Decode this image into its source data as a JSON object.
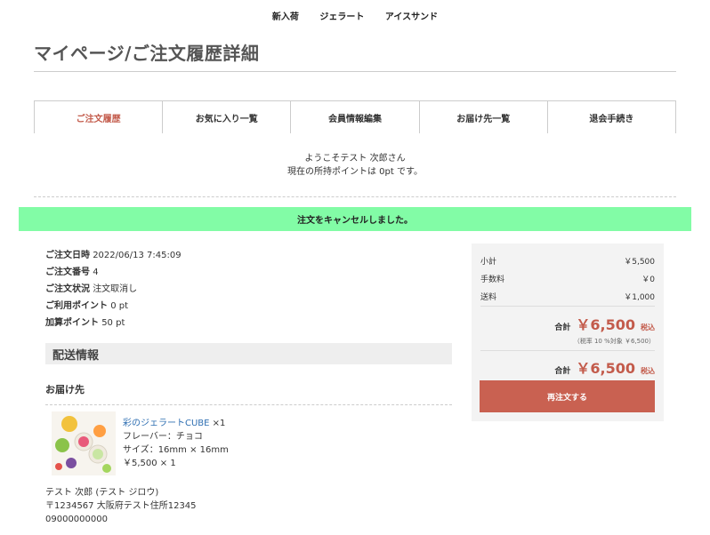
{
  "nav": {
    "items": [
      "新入荷",
      "ジェラート",
      "アイスサンド"
    ]
  },
  "page_title": "マイページ/ご注文履歴詳細",
  "tabs": [
    "ご注文履歴",
    "お気に入り一覧",
    "会員情報編集",
    "お届け先一覧",
    "退会手続き"
  ],
  "welcome": {
    "line1": "ようこそテスト 次郎さん",
    "line2": "現在の所持ポイントは 0pt です。"
  },
  "alert_message": "注文をキャンセルしました。",
  "order_info": {
    "date_label": "ご注文日時",
    "date_value": "2022/06/13 7:45:09",
    "number_label": "ご注文番号",
    "number_value": "4",
    "status_label": "ご注文状況",
    "status_value": "注文取消し",
    "used_points_label": "ご利用ポイント",
    "used_points_value": "0 pt",
    "added_points_label": "加算ポイント",
    "added_points_value": "50 pt"
  },
  "shipping": {
    "section_title": "配送情報",
    "ship_to_label": "お届け先",
    "product_name": "彩のジェラートCUBE",
    "product_qty": "×1",
    "flavor": "フレーバー：チョコ",
    "size": "サイズ：16mm × 16mm",
    "price": "￥5,500 × 1",
    "recipient": "テスト 次郎 (テスト ジロウ)",
    "address": "〒1234567 大阪府テスト住所12345",
    "phone": "09000000000"
  },
  "summary": {
    "subtotal_label": "小計",
    "subtotal_value": "￥5,500",
    "fee_label": "手数料",
    "fee_value": "￥0",
    "shipping_label": "送料",
    "shipping_value": "￥1,000",
    "total_label": "合計",
    "total_value": "￥6,500",
    "tax_label": "税込",
    "tax_note": "（税率 10 %対象 ￥6,500）",
    "grand_total_label": "合計",
    "grand_total_value": "￥6,500",
    "grand_tax_label": "税込",
    "reorder_button": "再注文する"
  },
  "colors": {
    "accent": "#c35b4b",
    "alert_bg": "#82fca6",
    "link": "#2f6fb2",
    "button": "#c96151"
  }
}
